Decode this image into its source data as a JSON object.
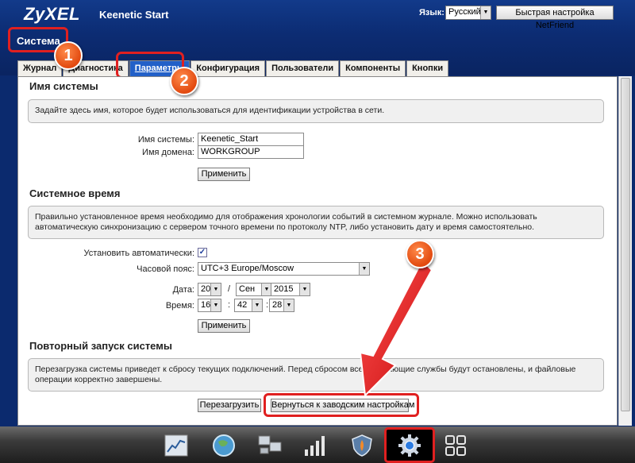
{
  "header": {
    "logo": "ZyXEL",
    "product": "Keenetic Start",
    "language_label": "Язык:",
    "language_value": "Русский",
    "netfriend_button": "Быстрая настройка NetFriend",
    "section_title": "Система"
  },
  "tabs": [
    {
      "label": "Журнал"
    },
    {
      "label": "Диагностика"
    },
    {
      "label": "Параметры",
      "active": true
    },
    {
      "label": "Конфигурация"
    },
    {
      "label": "Пользователи"
    },
    {
      "label": "Компоненты"
    },
    {
      "label": "Кнопки"
    }
  ],
  "system_name": {
    "title": "Имя системы",
    "info": "Задайте здесь имя, которое будет использоваться для идентификации устройства в сети.",
    "name_label": "Имя системы:",
    "name_value": "Keenetic_Start",
    "domain_label": "Имя домена:",
    "domain_value": "WORKGROUP",
    "apply_button": "Применить"
  },
  "system_time": {
    "title": "Системное время",
    "info": "Правильно установленное время необходимо для отображения хронологии событий в системном журнале. Можно использовать автоматическую синхронизацию с сервером точного времени по протоколу NTP, либо установить дату и время самостоятельно.",
    "auto_label": "Установить автоматически:",
    "auto_checked": true,
    "timezone_label": "Часовой пояс:",
    "timezone_value": "UTC+3 Europe/Moscow",
    "date_label": "Дата:",
    "date_day": "20",
    "date_month": "Сен",
    "date_year": "2015",
    "date_sep": "/",
    "time_label": "Время:",
    "time_hour": "16",
    "time_min": "42",
    "time_sec": "28",
    "time_sep": ":",
    "apply_button": "Применить"
  },
  "reboot": {
    "title": "Повторный запуск системы",
    "info": "Перезагрузка системы приведет к сбросу текущих подключений. Перед сбросом все работающие службы будут остановлены, и файловые операции корректно завершены.",
    "reboot_button": "Перезагрузить",
    "factory_button": "Вернуться к заводским настройкам"
  },
  "badges": [
    "1",
    "2",
    "3"
  ],
  "dock": [
    {
      "icon": "chart-icon"
    },
    {
      "icon": "globe-icon"
    },
    {
      "icon": "network-icon"
    },
    {
      "icon": "signal-bars-icon"
    },
    {
      "icon": "shield-icon"
    },
    {
      "icon": "gear-icon",
      "active": true
    },
    {
      "icon": "apps-grid-icon"
    }
  ],
  "colors": {
    "header_bg": "#0c2c73",
    "active_tab": "#2260c8",
    "highlight_ring": "#e02020",
    "badge": "#e24a10",
    "arrow": "#e02020"
  }
}
